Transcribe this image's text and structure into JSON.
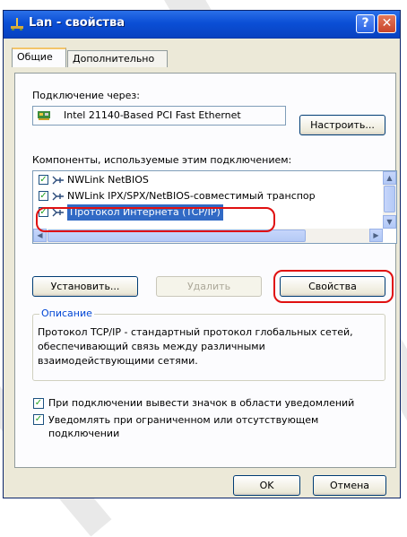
{
  "window": {
    "title": "Lan - свойства",
    "help_glyph": "?",
    "close_glyph": "✕"
  },
  "tabs": [
    {
      "label": "Общие",
      "active": true
    },
    {
      "label": "Дополнительно",
      "active": false
    }
  ],
  "connect_via": {
    "label": "Подключение через:",
    "adapter": "Intel 21140-Based PCI Fast Ethernet",
    "configure_button": "Настроить..."
  },
  "components": {
    "label": "Компоненты, используемые этим подключением:",
    "items": [
      {
        "label": "NWLink NetBIOS",
        "checked": true,
        "selected": false
      },
      {
        "label": "NWLink IPX/SPX/NetBIOS-совместимый транспор",
        "checked": true,
        "selected": false
      },
      {
        "label": "Протокол Интернета (TCP/IP)",
        "checked": true,
        "selected": true
      }
    ]
  },
  "buttons": {
    "install": "Установить...",
    "remove": "Удалить",
    "properties": "Свойства"
  },
  "description": {
    "title": "Описание",
    "text": "Протокол TCP/IP - стандартный протокол глобальных сетей, обеспечивающий связь между различными взаимодействующими сетями."
  },
  "options": [
    {
      "label": "При подключении вывести значок в области уведомлений",
      "checked": true
    },
    {
      "label": "Уведомлять при ограниченном или отсутствующем подключении",
      "checked": true
    }
  ],
  "footer": {
    "ok": "OK",
    "cancel": "Отмена"
  },
  "colors": {
    "title_bar": "#0b4fd6",
    "selection": "#316ac5",
    "highlight_oval": "#e01010",
    "group_title": "#0046d5"
  }
}
